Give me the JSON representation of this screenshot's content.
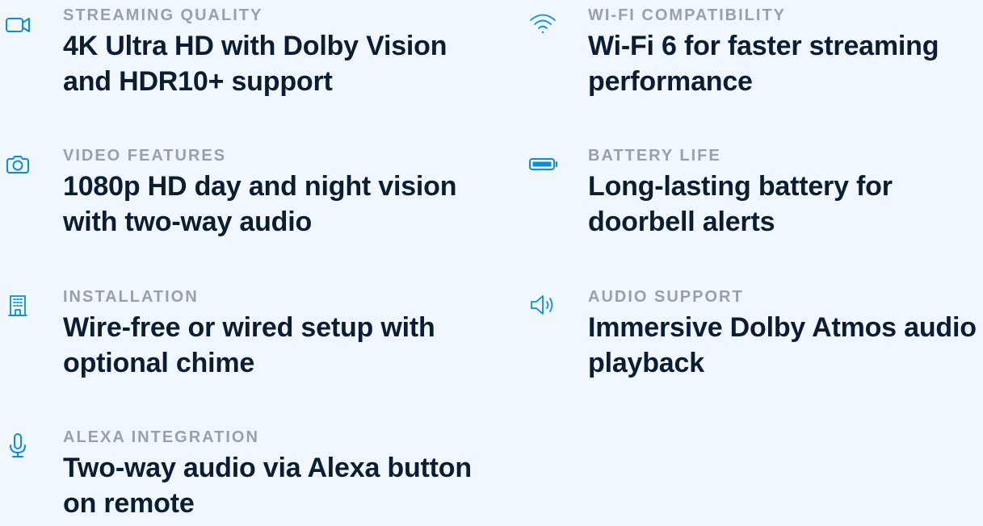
{
  "colors": {
    "background": "#f0f7fe",
    "icon": "#0a8fd6",
    "label": "#9aa0a9",
    "value": "#0c1d33"
  },
  "features": [
    {
      "icon": "video-camera-icon",
      "label": "STREAMING QUALITY",
      "value": "4K Ultra HD with Dolby Vision and HDR10+ support"
    },
    {
      "icon": "camera-icon",
      "label": "VIDEO FEATURES",
      "value": "1080p HD day and night vision with two-way audio"
    },
    {
      "icon": "building-icon",
      "label": "INSTALLATION",
      "value": "Wire-free or wired setup with optional chime"
    },
    {
      "icon": "microphone-icon",
      "label": "ALEXA INTEGRATION",
      "value": "Two-way audio via Alexa button on remote"
    },
    {
      "icon": "wifi-icon",
      "label": "WI-FI COMPATIBILITY",
      "value": "Wi-Fi 6 for faster streaming performance"
    },
    {
      "icon": "battery-icon",
      "label": "BATTERY LIFE",
      "value": "Long-lasting battery for doorbell alerts"
    },
    {
      "icon": "speaker-icon",
      "label": "AUDIO SUPPORT",
      "value": "Immersive Dolby Atmos audio playback"
    }
  ]
}
